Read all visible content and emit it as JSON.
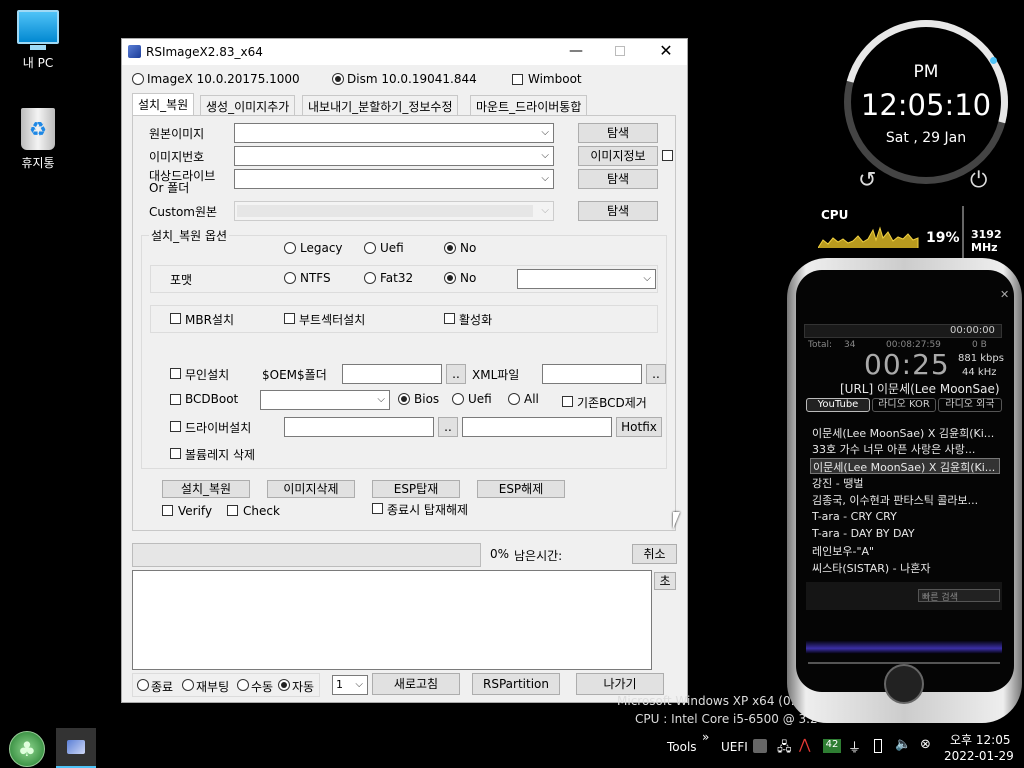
{
  "desktop": {
    "icons": [
      {
        "label": "내 PC"
      },
      {
        "label": "휴지통"
      }
    ]
  },
  "window": {
    "title": "RSImageX2.83_x64",
    "modes": [
      {
        "label": "ImageX 10.0.20175.1000",
        "selected": false
      },
      {
        "label": "Dism 10.0.19041.844",
        "selected": true
      }
    ],
    "wimboot_label": "Wimboot",
    "tabs": [
      "설치_복원",
      "생성_이미지추가",
      "내보내기_분할하기_정보수정",
      "마운트_드라이버통합"
    ],
    "fields": {
      "source_label": "원본이미지",
      "index_label": "이미지번호",
      "target_label_1": "대상드라이브",
      "target_label_2": "Or 폴더",
      "custom_label": "Custom원본",
      "browse": "탐색",
      "image_info": "이미지정보"
    },
    "options": {
      "group_label": "설치_복원 옵션",
      "boot_modes": [
        "Legacy",
        "Uefi",
        "No"
      ],
      "format_label": "포맷",
      "formats": [
        "NTFS",
        "Fat32",
        "No"
      ],
      "mbr": "MBR설치",
      "bootsector": "부트섹터설치",
      "activate": "활성화",
      "unattend": "무인설치",
      "oem": "$OEM$폴더",
      "xml": "XML파일",
      "dots": "..",
      "bcdboot": "BCDBoot",
      "bcd_modes": [
        "Bios",
        "Uefi",
        "All"
      ],
      "remove_bcd": "기존BCD제거",
      "driver": "드라이버설치",
      "hotfix": "Hotfix",
      "delete_volume": "볼륨레지 삭제"
    },
    "actions": {
      "install": "설치_복원",
      "delete_image": "이미지삭제",
      "esp_mount": "ESP탑재",
      "esp_unmount": "ESP해제",
      "verify": "Verify",
      "check": "Check",
      "unmount_on_exit": "종료시 탑재해제"
    },
    "progress": {
      "percent": "0%",
      "remaining_label": "남은시간:",
      "cancel": "취소",
      "seconds": "초"
    },
    "footer": {
      "after_modes": [
        "종료",
        "재부팅",
        "수동",
        "자동"
      ],
      "count": "1",
      "refresh": "새로고침",
      "rspartition": "RSPartition",
      "exit": "나가기"
    }
  },
  "clock": {
    "ampm": "PM",
    "time": "12:05:10",
    "date": "Sat , 29 Jan"
  },
  "cpu": {
    "label": "CPU",
    "percent": "19%",
    "freq": "3192 MHz"
  },
  "player": {
    "total_label": "Total:",
    "total_count": "34",
    "total_time": "00:08:27:59",
    "size": "0 B",
    "elapsed_display": "00:00:00",
    "time": "00:25",
    "bitrate": "881 kbps",
    "samplerate": "44 kHz",
    "now_playing": "[URL] 이문세(Lee MoonSae)",
    "tabs": [
      "YouTube",
      "라디오 KOR",
      "라디오 외국"
    ],
    "playlist": [
      "이문세(Lee MoonSae) X 김윤희(Ki...",
      "33호 가수 너무 아픈 사랑은 사랑...",
      "이문세(Lee MoonSae) X 김윤희(Ki...",
      "강진 - 땡벌",
      "김종국, 이수현과 판타스틱 콜라보...",
      "T-ara - CRY CRY",
      "T-ara - DAY BY DAY",
      "레인보우-\"A\"",
      "씨스타(SISTAR) - 나혼자"
    ],
    "search_placeholder": "빠른 검색"
  },
  "sysinfo": {
    "os": "Microsoft Windows XP x64 (0:1",
    "cpu": "CPU : Intel Core i5-6500 @ 3.2"
  },
  "taskbar": {
    "tools": "Tools",
    "uefi": "UEFI",
    "badge": "42",
    "time": "오후 12:05",
    "date": "2022-01-29"
  }
}
